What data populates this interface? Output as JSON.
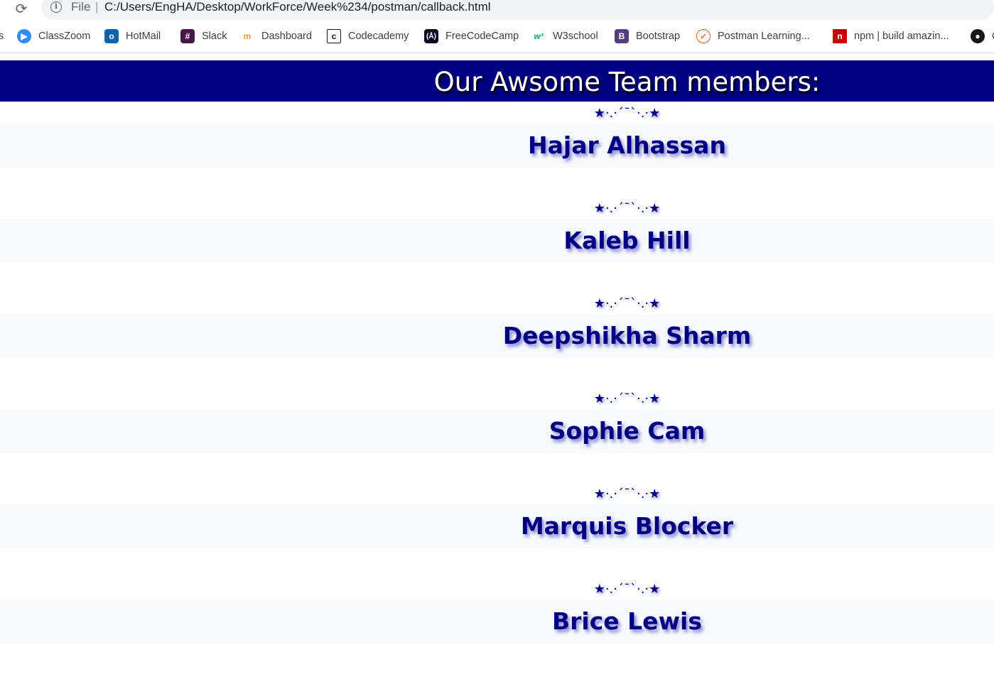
{
  "browser": {
    "scheme_label": "File",
    "separator": "|",
    "url": "C:/Users/EngHA/Desktop/WorkForce/Week%234/postman/callback.html"
  },
  "bookmarks": [
    {
      "label": "s",
      "icon": "none"
    },
    {
      "label": "ClassZoom",
      "icon": "zoom-icon",
      "color": "#2d8cff"
    },
    {
      "label": "HotMail",
      "icon": "outlook-icon",
      "color": "#0a64ad"
    },
    {
      "label": "Slack",
      "icon": "slack-icon",
      "color": "#4a154b"
    },
    {
      "label": "Dashboard",
      "icon": "dashboard-icon",
      "color": "#f7931e"
    },
    {
      "label": "Codecademy",
      "icon": "codecademy-icon",
      "color": "#10162f"
    },
    {
      "label": "FreeCodeCamp",
      "icon": "freecodecamp-icon",
      "color": "#0a0a23"
    },
    {
      "label": "W3school",
      "icon": "w3schools-icon",
      "color": "#04aa6d"
    },
    {
      "label": "Bootstrap",
      "icon": "bootstrap-icon",
      "color": "#563d7c"
    },
    {
      "label": "Postman Learning...",
      "icon": "postman-icon",
      "color": "#ef5b25"
    },
    {
      "label": "npm | build amazin...",
      "icon": "npm-icon",
      "color": "#cb0000"
    },
    {
      "label": "C",
      "icon": "github-icon",
      "color": "#181717"
    }
  ],
  "page": {
    "header_title": "Our Awsome Team members:",
    "divider": "★·.·´¯`·.·★",
    "members": [
      {
        "name": "Hajar Alhassan"
      },
      {
        "name": "Kaleb Hill"
      },
      {
        "name": "Deepshikha Sharm"
      },
      {
        "name": "Sophie Cam"
      },
      {
        "name": "Marquis Blocker"
      },
      {
        "name": "Brice Lewis"
      }
    ]
  },
  "colors": {
    "header_bg": "#000080",
    "name_color": "#000080",
    "band_bg": "#f8f9fa"
  }
}
